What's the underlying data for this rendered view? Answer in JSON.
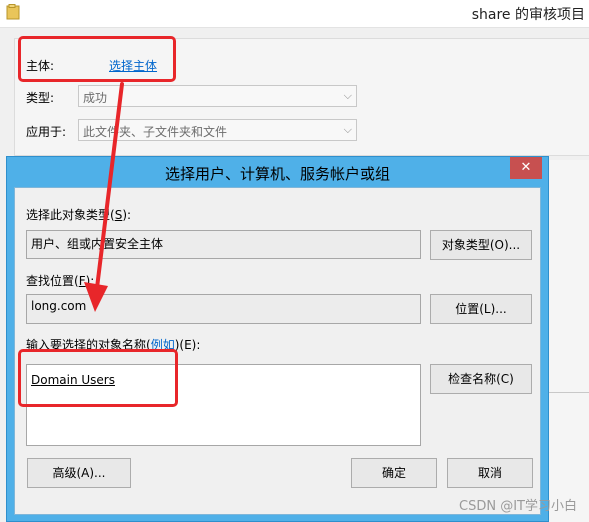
{
  "background_window": {
    "title": "share 的审核项目",
    "principal_label": "主体:",
    "principal_link": "选择主体",
    "type_label": "类型:",
    "type_value": "成功",
    "applies_label": "应用于:",
    "applies_value": "此文件夹、子文件夹和文件"
  },
  "dialog": {
    "title": "选择用户、计算机、服务帐户或组",
    "close_glyph": "✕",
    "object_type_label_prefix": "选择此对象类型(",
    "object_type_label_key": "S",
    "object_type_label_suffix": "):",
    "object_type_value": "用户、组或内置安全主体",
    "object_type_button": "对象类型(O)...",
    "location_label_prefix": "查找位置(",
    "location_label_key": "F",
    "location_label_suffix": "):",
    "location_value": "long.com",
    "location_button": "位置(L)...",
    "names_label_prefix": "输入要选择的对象名称(",
    "names_label_link": "例如",
    "names_label_suffix": ")(E):",
    "names_value": "Domain Users",
    "check_names_button": "检查名称(C)",
    "advanced_button": "高级(A)...",
    "ok_button": "确定",
    "cancel_button": "取消"
  },
  "watermark": "CSDN @IT学习小白",
  "colors": {
    "annotation_red": "#e8262a",
    "dialog_frame": "#4fb0e8",
    "link_blue": "#0066cc"
  }
}
